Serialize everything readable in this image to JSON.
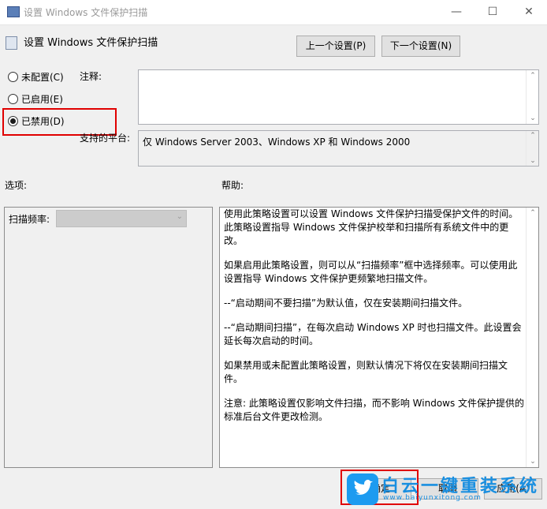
{
  "window": {
    "title": "设置 Windows 文件保护扫描",
    "minimize": "—",
    "maximize": "☐",
    "close": "✕"
  },
  "header": {
    "policy_name": "设置 Windows 文件保护扫描",
    "prev_button": "上一个设置(P)",
    "next_button": "下一个设置(N)"
  },
  "state": {
    "options": [
      {
        "label": "未配置(C)",
        "selected": false
      },
      {
        "label": "已启用(E)",
        "selected": false
      },
      {
        "label": "已禁用(D)",
        "selected": true
      }
    ]
  },
  "comment": {
    "label": "注释:",
    "value": ""
  },
  "supported": {
    "label": "支持的平台:",
    "value": "仅 Windows Server 2003、Windows XP 和 Windows 2000"
  },
  "options_panel": {
    "label": "选项:",
    "scan_freq_label": "扫描频率:",
    "scan_freq_value": ""
  },
  "help_panel": {
    "label": "帮助:",
    "paragraphs": [
      "使用此策略设置可以设置 Windows 文件保护扫描受保护文件的时间。此策略设置指导 Windows 文件保护校举和扫描所有系统文件中的更改。",
      "如果启用此策略设置，则可以从“扫描频率”框中选择频率。可以使用此设置指导 Windows 文件保护更频繁地扫描文件。",
      "--“启动期间不要扫描”为默认值，仅在安装期间扫描文件。",
      "--“启动期间扫描”，在每次启动 Windows XP 时也扫描文件。此设置会延长每次启动的时间。",
      "如果禁用或未配置此策略设置，则默认情况下将仅在安装期间扫描文件。",
      "注意: 此策略设置仅影响文件扫描，而不影响 Windows 文件保护提供的标准后台文件更改检测。"
    ]
  },
  "footer": {
    "ok": "确定",
    "cancel": "取消",
    "apply": "应用(A)"
  },
  "watermark": {
    "title": "白云一键重装系统",
    "url": "www.baiyunxitong.com"
  }
}
